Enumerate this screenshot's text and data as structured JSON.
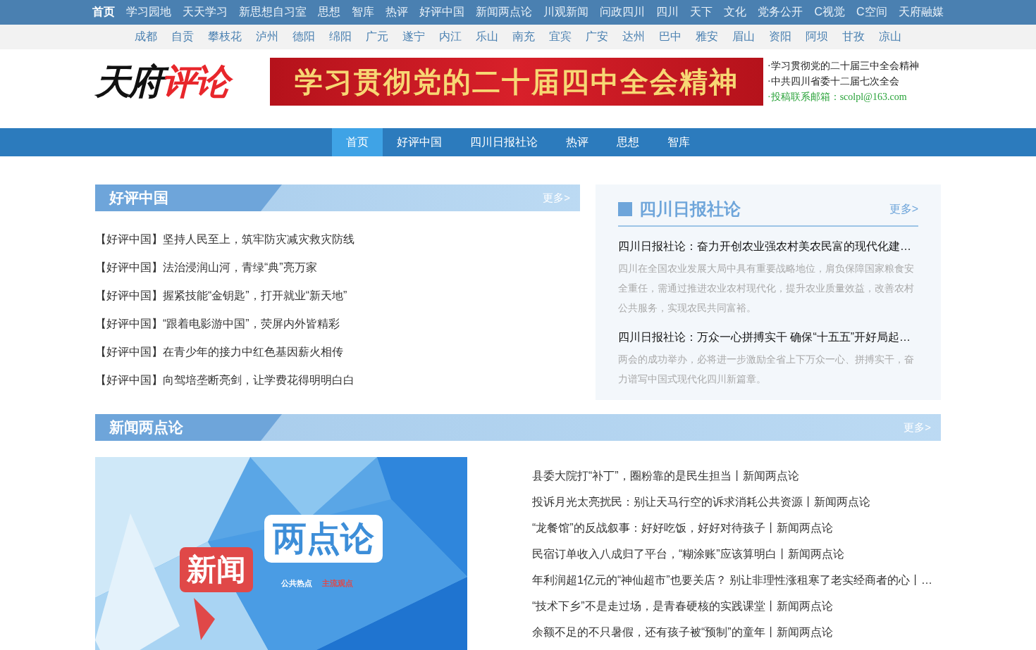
{
  "top_nav": [
    {
      "label": "首页",
      "selected": true
    },
    {
      "label": "学习园地",
      "selected": false
    },
    {
      "label": "天天学习",
      "selected": false
    },
    {
      "label": "新思想自习室",
      "selected": false
    },
    {
      "label": "思想",
      "selected": false
    },
    {
      "label": "智库",
      "selected": false
    },
    {
      "label": "热评",
      "selected": false
    },
    {
      "label": "好评中国",
      "selected": false
    },
    {
      "label": "新闻两点论",
      "selected": false
    },
    {
      "label": "川观新闻",
      "selected": false
    },
    {
      "label": "问政四川",
      "selected": false
    },
    {
      "label": "四川",
      "selected": false
    },
    {
      "label": "天下",
      "selected": false
    },
    {
      "label": "文化",
      "selected": false
    },
    {
      "label": "党务公开",
      "selected": false
    },
    {
      "label": "C视觉",
      "selected": false
    },
    {
      "label": "C空间",
      "selected": false
    },
    {
      "label": "天府融媒",
      "selected": false
    }
  ],
  "region_nav": [
    "成都",
    "自贡",
    "攀枝花",
    "泸州",
    "德阳",
    "绵阳",
    "广元",
    "遂宁",
    "内江",
    "乐山",
    "南充",
    "宜宾",
    "广安",
    "达州",
    "巴中",
    "雅安",
    "眉山",
    "资阳",
    "阿坝",
    "甘孜",
    "凉山"
  ],
  "header": {
    "logo_dark": "天府",
    "logo_red": "评论",
    "banner": "学习贯彻党的二十届四中全会精神",
    "notices": [
      {
        "text": "·学习贯彻党的二十届三中全会精神",
        "kind": "link"
      },
      {
        "text": "·中共四川省委十二届七次全会",
        "kind": "link"
      },
      {
        "text": "·投稿联系邮箱：scolpl@163.com",
        "kind": "contact"
      }
    ]
  },
  "main_nav": [
    {
      "label": "首页",
      "selected": true
    },
    {
      "label": "好评中国",
      "selected": false
    },
    {
      "label": "四川日报社论",
      "selected": false
    },
    {
      "label": "热评",
      "selected": false
    },
    {
      "label": "思想",
      "selected": false
    },
    {
      "label": "智库",
      "selected": false
    }
  ],
  "haoping": {
    "title": "好评中国",
    "more": "更多>",
    "items": [
      "【好评中国】坚持人民至上，筑牢防灾减灾救灾防线",
      "【好评中国】法治浸润山河，青绿“典”亮万家",
      "【好评中国】握紧技能“金钥匙”，打开就业“新天地”",
      "【好评中国】“跟着电影游中国”，荧屏内外皆精彩",
      "【好评中国】在青少年的接力中红色基因薪火相传",
      "【好评中国】向驾培垄断亮剑，让学费花得明明白白"
    ]
  },
  "sichuan": {
    "title": "四川日报社论",
    "more": "更多>",
    "articles": [
      {
        "title": "四川日报社论：奋力开创农业强农村美农民富的现代化建…",
        "summary": "四川在全国农业发展大局中具有重要战略地位，肩负保障国家粮食安全重任，需通过推进农业农村现代化，提升农业质量效益，改善农村公共服务，实现农民共同富裕。"
      },
      {
        "title": "四川日报社论：万众一心拼搏实干 确保“十五五”开好局起…",
        "summary": "两会的成功举办，必将进一步激励全省上下万众一心、拼搏实干，奋力谱写中国式现代化四川新篇章。"
      }
    ]
  },
  "xinwen": {
    "title": "新闻两点论",
    "more": "更多>",
    "image": {
      "red_bubble": "新闻",
      "white_bubble": "两点论",
      "tag_white": "公共热点",
      "tag_red": "主流观点"
    },
    "items": [
      "县委大院打“补丁”，圈粉靠的是民生担当丨新闻两点论",
      "投诉月光太亮扰民：别让天马行空的诉求消耗公共资源丨新闻两点论",
      "“龙餐馆”的反战叙事：好好吃饭，好好对待孩子丨新闻两点论",
      "民宿订单收入八成归了平台，“糊涂账”应该算明白丨新闻两点论",
      "年利润超1亿元的“神仙超市”也要关店？ 别让非理性涨租寒了老实经商者的心丨…",
      "“技术下乡”不是走过场，是青春硬核的实践课堂丨新闻两点论",
      "余额不足的不只暑假，还有孩子被“预制”的童年丨新闻两点论"
    ]
  }
}
